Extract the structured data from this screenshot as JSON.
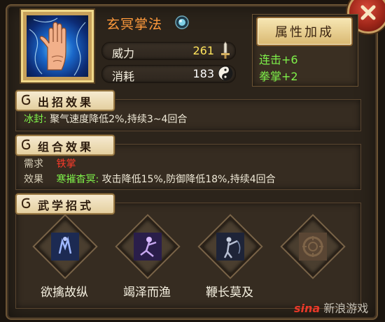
{
  "skill": {
    "name": "玄冥掌法",
    "icon": "palm-icon",
    "gem_icon": "blue-gem-icon"
  },
  "stats": [
    {
      "label": "威力",
      "value": "261",
      "icon": "sword-icon"
    },
    {
      "label": "消耗",
      "value": "183",
      "icon": "yin-yang-icon"
    }
  ],
  "bonus": {
    "button_label": "属性加成",
    "lines": [
      "连击+6",
      "拳掌+2"
    ]
  },
  "sections": {
    "effect": {
      "title": "出招效果",
      "tag": "冰封:",
      "text": "聚气速度降低2%,持续3~4回合"
    },
    "combo": {
      "title": "组合效果",
      "req_label": "需求",
      "req_value": "铁掌",
      "eff_label": "效果",
      "eff_tag": "寒摧杳冥:",
      "eff_text": "攻击降低15%,防御降低18%,持续4回合"
    },
    "moves": {
      "title": "武学招式",
      "items": [
        {
          "label": "欲擒故纵",
          "icon": "move-icon-1"
        },
        {
          "label": "竭泽而渔",
          "icon": "move-icon-2"
        },
        {
          "label": "鞭长莫及",
          "icon": "move-icon-3"
        },
        {
          "label": "",
          "icon": "locked-slot-icon"
        }
      ]
    }
  },
  "watermark": {
    "logo": "sina",
    "text": "新浪游戏"
  },
  "colors": {
    "skill_name": "#ff9a3c",
    "highlight_green": "#7ff24a",
    "requirement_red": "#ff3b2a",
    "stat_gold": "#ffe45c"
  }
}
